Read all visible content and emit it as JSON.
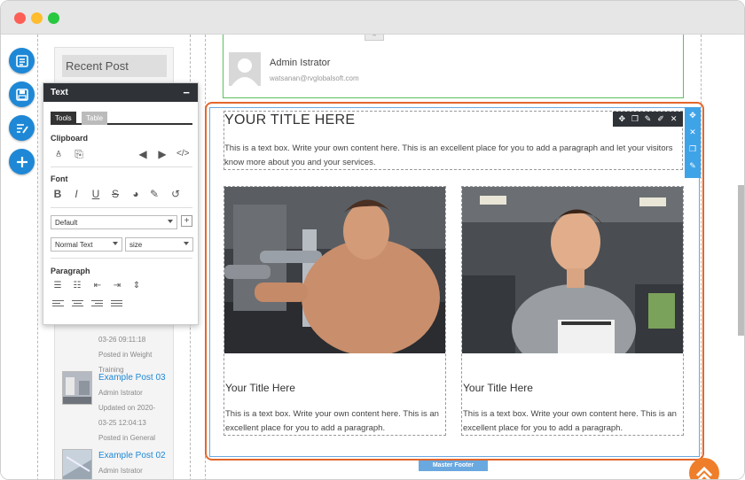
{
  "sidebar": {
    "recent_post_label": "Recent Post",
    "posts": [
      {
        "date_cont": "03-26 09:11:18",
        "category": "Posted in Weight",
        "category_cont": "Training"
      },
      {
        "title": "Example Post 03",
        "author": "Admin Istrator",
        "updated": "Updated on 2020-",
        "updated_cont": "03-25 12:04:13",
        "category": "Posted in General"
      },
      {
        "title": "Example Post 02",
        "author": "Admin Istrator"
      }
    ]
  },
  "text_panel": {
    "title": "Text",
    "minimize": "−",
    "tabs": {
      "tools": "Tools",
      "table": "Table"
    },
    "clipboard_label": "Clipboard",
    "font_label": "Font",
    "paragraph_label": "Paragraph",
    "font_family": "Default",
    "text_style": "Normal Text",
    "size_placeholder": "size",
    "plus": "+"
  },
  "author": {
    "name": "Admin Istrator",
    "email": "watsanan@rvglobalsoft.com"
  },
  "content": {
    "title": "YOUR TITLE HERE",
    "text": "This is a text box. Write your own content here. This is an excellent place for you to add a paragraph and let your visitors know more about you and your services.",
    "cards": [
      {
        "title": "Your Title Here",
        "text": "This is a text box. Write your own content here. This is an excellent place for you to add a paragraph."
      },
      {
        "title": "Your Title Here",
        "text": "This is a text box. Write your own content here. This is an excellent place for you to add a paragraph."
      }
    ]
  },
  "footer_tab": "Master Footer",
  "icons": {
    "window_close": "red-dot",
    "window_minimize": "yellow-dot",
    "window_zoom": "green-dot",
    "tool_1": "page-layout-icon",
    "tool_2": "save-icon",
    "tool_3": "edit-list-icon",
    "tool_4": "add-icon",
    "scroll_top": "chevron-up-icon"
  },
  "colors": {
    "accent_blue": "#1e88d6",
    "section_orange": "#e4672c",
    "author_border_green": "#5cbf5c",
    "inner_blue": "#6aa8e0"
  }
}
